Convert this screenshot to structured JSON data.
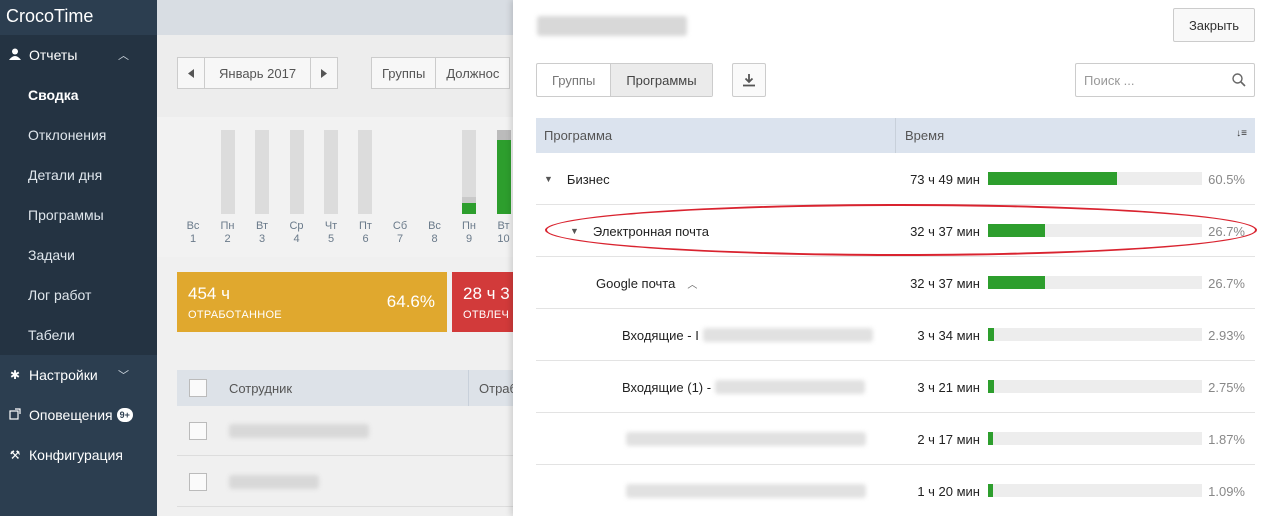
{
  "sidebar": {
    "brand": "CrocoTime",
    "reports_label": "Отчеты",
    "reports_items": [
      "Сводка",
      "Отклонения",
      "Детали дня",
      "Программы",
      "Задачи",
      "Лог работ",
      "Табели"
    ],
    "settings_label": "Настройки",
    "alerts_label": "Оповещения",
    "alerts_badge": "9+",
    "config_label": "Конфигурация"
  },
  "background": {
    "month": "Январь 2017",
    "groups_btn": "Группы",
    "positions_btn": "Должнос",
    "days": [
      {
        "d": "Вс",
        "n": "1"
      },
      {
        "d": "Пн",
        "n": "2"
      },
      {
        "d": "Вт",
        "n": "3"
      },
      {
        "d": "Ср",
        "n": "4"
      },
      {
        "d": "Чт",
        "n": "5"
      },
      {
        "d": "Пт",
        "n": "6"
      },
      {
        "d": "Сб",
        "n": "7"
      },
      {
        "d": "Вс",
        "n": "8"
      },
      {
        "d": "Пн",
        "n": "9"
      },
      {
        "d": "Вт",
        "n": "10"
      }
    ],
    "worked": {
      "value": "454 ч",
      "label": "ОТРАБОТАННОЕ",
      "pct": "64.6%",
      "color": "#e0a82e"
    },
    "distracted": {
      "value": "28 ч 3",
      "label": "ОТВЛЕЧ",
      "color": "#d23a3a"
    },
    "col_employee": "Сотрудник",
    "col_worked": "Отраб"
  },
  "panel": {
    "close_label": "Закрыть",
    "tabs": [
      "Группы",
      "Программы"
    ],
    "search_placeholder": "Поиск ...",
    "col_program": "Программа",
    "col_time": "Время",
    "rows": [
      {
        "name": "Бизнес",
        "time": "73 ч 49 мин",
        "pct": "60.5%",
        "fill": 60.5
      },
      {
        "name": "Электронная почта",
        "time": "32 ч 37 мин",
        "pct": "26.7%",
        "fill": 26.7
      },
      {
        "name": "Google почта",
        "time": "32 ч 37 мин",
        "pct": "26.7%",
        "fill": 26.7
      },
      {
        "name": "Входящие - I",
        "time": "3 ч 34 мин",
        "pct": "2.93%",
        "fill": 2.93
      },
      {
        "name": "Входящие (1) -",
        "time": "3 ч 21 мин",
        "pct": "2.75%",
        "fill": 2.75
      },
      {
        "name": "",
        "time": "2 ч 17 мин",
        "pct": "1.87%",
        "fill": 1.87
      },
      {
        "name": "",
        "time": "1 ч 20 мин",
        "pct": "1.09%",
        "fill": 1.09
      }
    ],
    "bar_color": "#2d9e2d"
  }
}
